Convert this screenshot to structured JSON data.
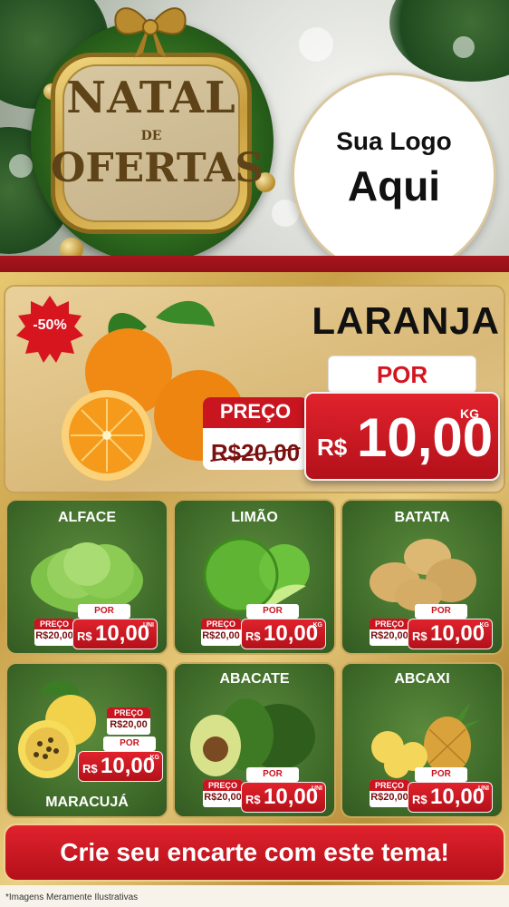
{
  "header": {
    "brand_line1": "NATAL",
    "brand_line2": "DE",
    "brand_line3": "OFERTAS",
    "logo_line1": "Sua Logo",
    "logo_line2": "Aqui"
  },
  "featured": {
    "discount": "-50%",
    "name": "LARANJA",
    "por_label": "POR",
    "preco_label": "PREÇO",
    "old_price": "R$20,00",
    "currency": "R$",
    "price": "10,00",
    "unit": "KG"
  },
  "products": [
    {
      "name": "ALFACE",
      "preco_label": "PREÇO",
      "old_price": "R$20,00",
      "por_label": "POR",
      "currency": "R$",
      "price": "10,00",
      "unit": "UNI"
    },
    {
      "name": "LIMÃO",
      "preco_label": "PREÇO",
      "old_price": "R$20,00",
      "por_label": "POR",
      "currency": "R$",
      "price": "10,00",
      "unit": "KG"
    },
    {
      "name": "BATATA",
      "preco_label": "PREÇO",
      "old_price": "R$20,00",
      "por_label": "POR",
      "currency": "R$",
      "price": "10,00",
      "unit": "KG"
    },
    {
      "name": "MARACUJÁ",
      "preco_label": "PREÇO",
      "old_price": "R$20,00",
      "por_label": "POR",
      "currency": "R$",
      "price": "10,00",
      "unit": "KG"
    },
    {
      "name": "ABACATE",
      "preco_label": "PREÇO",
      "old_price": "R$20,00",
      "por_label": "POR",
      "currency": "R$",
      "price": "10,00",
      "unit": "UNI"
    },
    {
      "name": "ABCAXI",
      "preco_label": "PREÇO",
      "old_price": "R$20,00",
      "por_label": "POR",
      "currency": "R$",
      "price": "10,00",
      "unit": "UNI"
    }
  ],
  "cta": "Crie seu encarte com este tema!",
  "disclaimer": "*Imagens Meramente Ilustrativas",
  "colors": {
    "red": "#c91520",
    "gold": "#d2ad5b",
    "green": "#3e6a29"
  }
}
